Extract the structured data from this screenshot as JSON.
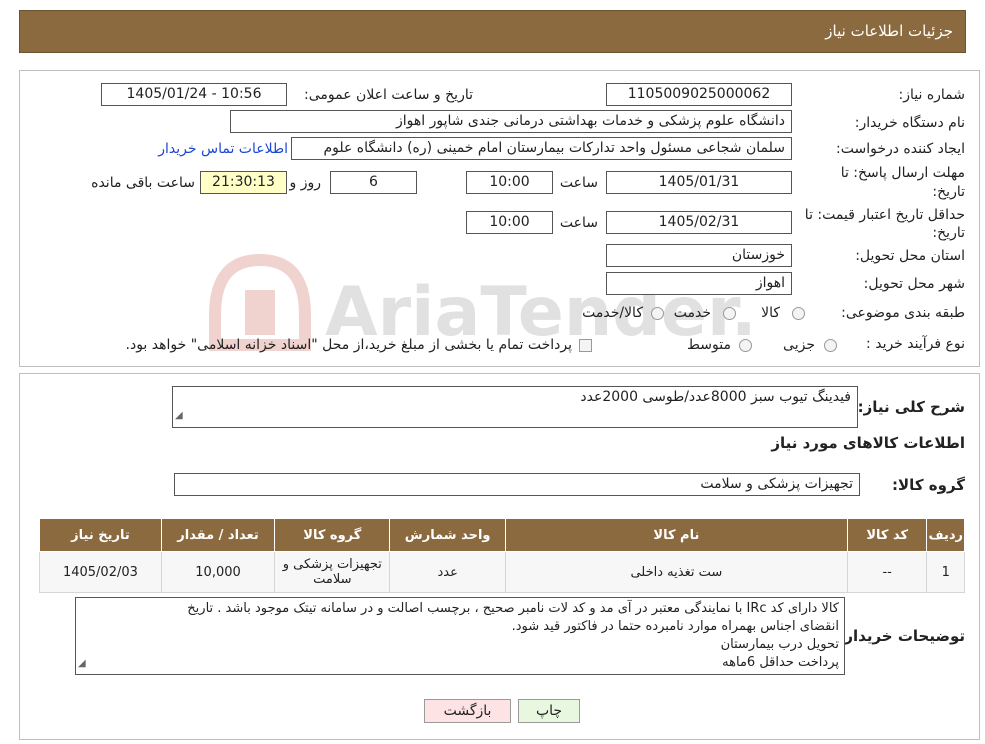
{
  "header": {
    "title": "جزئیات اطلاعات نیاز"
  },
  "watermark": {
    "text": "AriaTender.neT"
  },
  "form": {
    "need_number_label": "شماره نیاز:",
    "need_number": "1105009025000062",
    "announce_label": "تاریخ و ساعت اعلان عمومی:",
    "announce_value": "1405/01/24 - 10:56",
    "buyer_org_label": "نام دستگاه خریدار:",
    "buyer_org": "دانشگاه علوم پزشکی و خدمات بهداشتی درمانی جندی شاپور اهواز",
    "requester_label": "ایجاد کننده درخواست:",
    "requester": "سلمان شجاعی مسئول واحد تدارکات بیمارستان امام خمینی (ره) دانشگاه علوم",
    "contact_link": "اطلاعات تماس خریدار",
    "deadline_label_1": "مهلت ارسال پاسخ: تا",
    "deadline_label_2": "تاریخ:",
    "deadline_date": "1405/01/31",
    "time_label": "ساعت",
    "deadline_time": "10:00",
    "days_value": "6",
    "days_label": "روز و",
    "remaining_time": "21:30:13",
    "remaining_label": "ساعت باقی مانده",
    "validity_label_1": "حداقل تاریخ اعتبار قیمت: تا",
    "validity_label_2": "تاریخ:",
    "validity_date": "1405/02/31",
    "validity_time": "10:00",
    "province_label": "استان محل تحویل:",
    "province": "خوزستان",
    "city_label": "شهر محل تحویل:",
    "city": "اهواز",
    "category_label": "طبقه بندی موضوعی:",
    "category_options": [
      "کالا",
      "خدمت",
      "کالا/خدمت"
    ],
    "process_label": "نوع فرآیند خرید :",
    "process_options": [
      "جزیی",
      "متوسط"
    ],
    "process_note": "پرداخت تمام یا بخشی از مبلغ خرید،از محل \"اسناد خزانه اسلامی\" خواهد بود."
  },
  "summary": {
    "label": "شرح کلی نیاز:",
    "value": "فیدینگ تیوب سبز  8000عدد/طوسی 2000عدد"
  },
  "goods": {
    "section_title": "اطلاعات کالاهای مورد نیاز",
    "group_label": "گروه کالا:",
    "group_value": "تجهیزات پزشکی و سلامت",
    "columns": [
      "ردیف",
      "کد کالا",
      "نام کالا",
      "واحد شمارش",
      "گروه کالا",
      "تعداد / مقدار",
      "تاریخ نیاز"
    ],
    "rows": [
      [
        "1",
        "--",
        "ست تغذیه داخلی",
        "عدد",
        "تجهیزات پزشکی و سلامت",
        "10,000",
        "1405/02/03"
      ]
    ]
  },
  "notes": {
    "label": "توضیحات خریدار:",
    "lines": [
      "کالا دارای کد IRc با نمایندگی معتبر در آی مد و کد لات نامبر صحیح ، برچسب اصالت و در سامانه تیتک موجود باشد . تاریخ",
      "انقضای اجناس بهمراه موارد نامبرده حتما در فاکتور قید شود.",
      "تحویل درب بیمارستان",
      "پرداخت حداقل 6ماهه"
    ]
  },
  "buttons": {
    "print": "چاپ",
    "back": "بازگشت"
  }
}
